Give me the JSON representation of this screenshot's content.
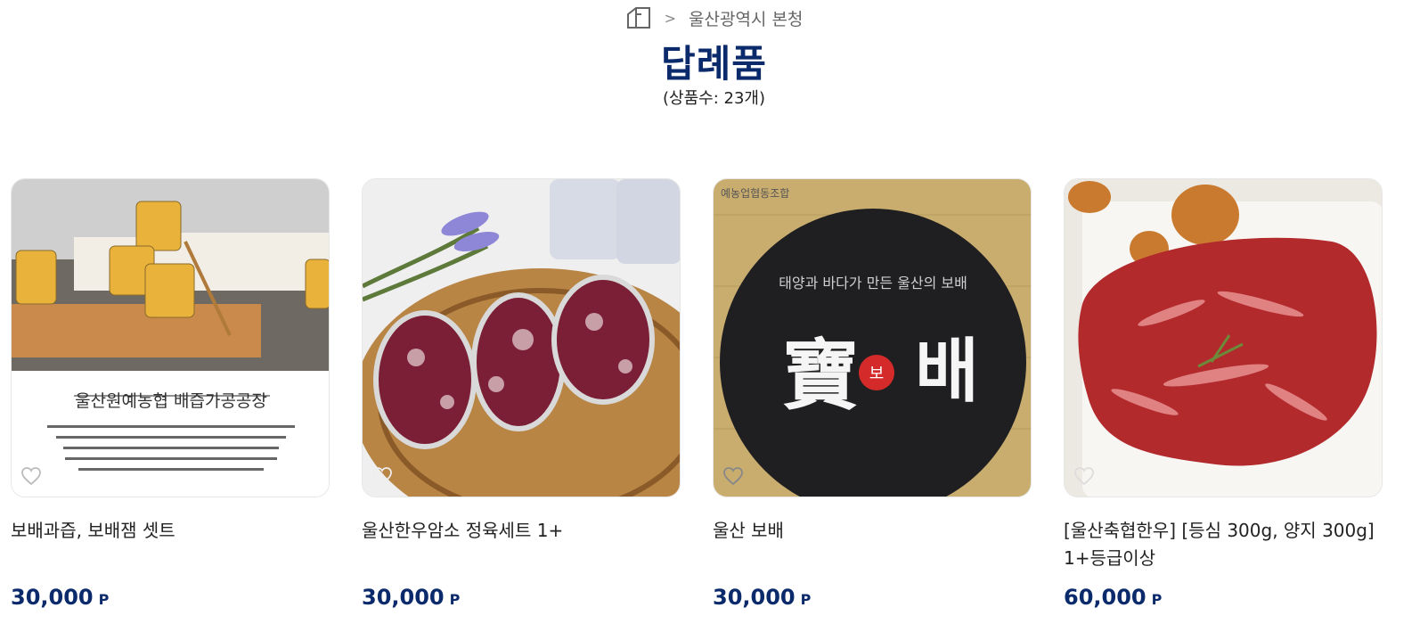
{
  "breadcrumb": {
    "home_icon": "home-icon",
    "separator": ">",
    "current": "울산광역시 본청"
  },
  "page": {
    "title": "답례품",
    "count_text": "(상품수: 23개)"
  },
  "colors": {
    "accent": "#0b2a6b",
    "text": "#222222"
  },
  "products": [
    {
      "name": "보배과즙, 보배잼 셋트",
      "price": "30,000",
      "unit": "P",
      "image_caption": "울산원예농협 배즙가공공장"
    },
    {
      "name": "울산한우암소 정육세트 1+",
      "price": "30,000",
      "unit": "P"
    },
    {
      "name": "울산 보배",
      "price": "30,000",
      "unit": "P",
      "image_text": {
        "top": "태양과 바다가 만든 울산의 보배",
        "brand": "寶 보 배"
      }
    },
    {
      "name": "[울산축협한우] [등심 300g, 양지 300g] 1+등급이상",
      "price": "60,000",
      "unit": "P"
    }
  ]
}
